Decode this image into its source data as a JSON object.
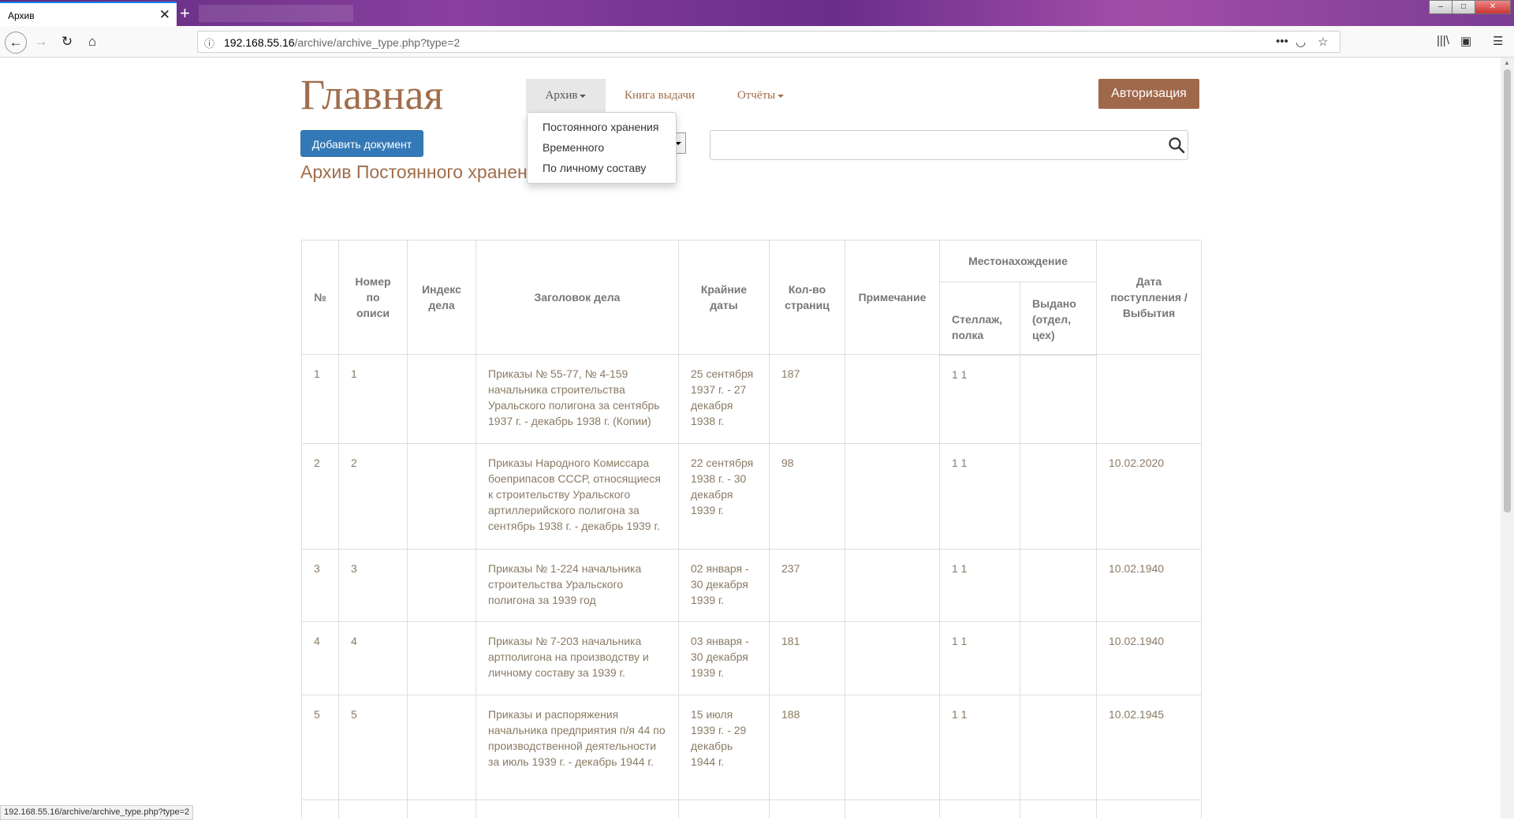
{
  "browser": {
    "tab_title": "Архив",
    "url_host": "192.168.55.16",
    "url_path": "/archive/archive_type.php?type=2",
    "status_text": "192.168.55.16/archive/archive_type.php?type=2"
  },
  "nav": {
    "site_title": "Главная",
    "archive": "Архив",
    "books": "Книга выдачи",
    "reports": "Отчёты",
    "auth": "Авторизация"
  },
  "dropdown": {
    "items": [
      "Постоянного хранения",
      "Временного",
      "По личному составу"
    ]
  },
  "add_document": "Добавить документ",
  "page_heading": "Архив Постоянного хранения",
  "table": {
    "headers": {
      "num": "№",
      "inventory_num": "Номер по описи",
      "index": "Индекс дела",
      "title": "Заголовок дела",
      "dates": "Крайние даты",
      "pages": "Кол-во страниц",
      "note": "Примечание",
      "location": "Местонахождение",
      "shelf": "Стеллаж, полка",
      "issued": "Выдано (отдел, цех)",
      "received": "Дата поступления / Выбытия"
    },
    "rows": [
      {
        "num": "1",
        "inv": "1",
        "index": "",
        "title": "Приказы № 55-77, № 4-159 начальника строительства Уральского полигона за сентябрь 1937 г. - декабрь 1938 г. (Копии)",
        "dates": "25 сентября 1937 г. - 27 декабря 1938 г.",
        "pages": "187",
        "note": "",
        "shelf": "1 1",
        "issued": "",
        "received": ""
      },
      {
        "num": "2",
        "inv": "2",
        "index": "",
        "title": "Приказы Народного Комиссара боеприпасов СССР, относящиеся к строительству Уральского артиллерийского полигона за сентябрь 1938 г. - декабрь 1939 г.",
        "dates": "22 сентября 1938 г. - 30 декабря 1939 г.",
        "pages": "98",
        "note": "",
        "shelf": "1 1",
        "issued": "",
        "received": "10.02.2020"
      },
      {
        "num": "3",
        "inv": "3",
        "index": "",
        "title": "Приказы № 1-224 начальника строительства Уральского полигона за 1939 год",
        "dates": "02 января - 30 декабря 1939 г.",
        "pages": "237",
        "note": "",
        "shelf": "1 1",
        "issued": "",
        "received": "10.02.1940"
      },
      {
        "num": "4",
        "inv": "4",
        "index": "",
        "title": "Приказы № 7-203 начальника артполигона на производству и личному составу за 1939 г.",
        "dates": "03 января - 30 декабря 1939 г.",
        "pages": "181",
        "note": "",
        "shelf": "1 1",
        "issued": "",
        "received": "10.02.1940"
      },
      {
        "num": "5",
        "inv": "5",
        "index": "",
        "title": "Приказы и распоряжения начальника предприятия п/я 44 по производственной деятельности за июль 1939 г. - декабрь 1944 г.",
        "dates": "15 июля 1939 г. - 29 декабрь 1944 г.",
        "pages": "188",
        "note": "",
        "shelf": "1 1",
        "issued": "",
        "received": "10.02.1945"
      }
    ]
  }
}
